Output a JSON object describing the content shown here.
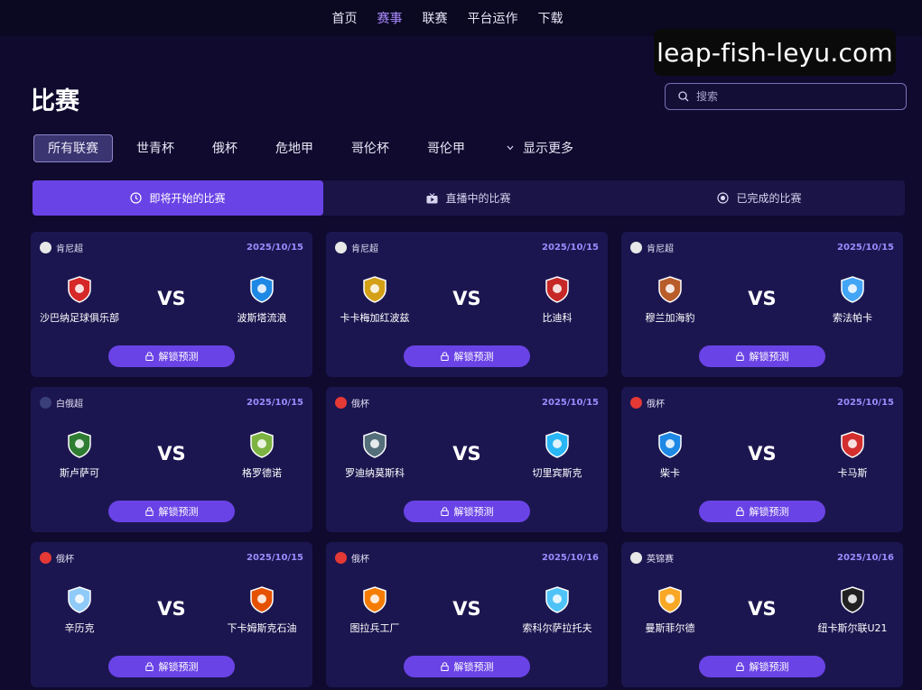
{
  "nav": {
    "items": [
      {
        "label": "首页",
        "active": false
      },
      {
        "label": "赛事",
        "active": true
      },
      {
        "label": "联赛",
        "active": false
      },
      {
        "label": "平台运作",
        "active": false
      },
      {
        "label": "下载",
        "active": false
      }
    ]
  },
  "watermark": "leap-fish-leyu.com",
  "page": {
    "title": "比赛"
  },
  "search": {
    "placeholder": "搜索",
    "value": ""
  },
  "league_filter": {
    "items": [
      "所有联赛",
      "世青杯",
      "俄杯",
      "危地甲",
      "哥伦杯",
      "哥伦甲"
    ],
    "active_index": 0,
    "show_more": "显示更多"
  },
  "status_tabs": [
    {
      "label": "即将开始的比赛",
      "icon": "clock-icon",
      "active": true
    },
    {
      "label": "直播中的比赛",
      "icon": "tv-icon",
      "active": false
    },
    {
      "label": "已完成的比赛",
      "icon": "circle-dot-icon",
      "active": false
    }
  ],
  "vs_label": "VS",
  "unlock_label": "解锁预测",
  "matches": [
    {
      "league": "肯尼超",
      "date": "2025/10/15",
      "home": "沙巴纳足球俱乐部",
      "away": "波斯塔流浪",
      "league_color": "#e8e8e8",
      "home_color": "#d62828",
      "away_color": "#1e88e5"
    },
    {
      "league": "肯尼超",
      "date": "2025/10/15",
      "home": "卡卡梅加红波兹",
      "away": "比迪科",
      "league_color": "#e8e8e8",
      "home_color": "#d4a017",
      "away_color": "#c62828"
    },
    {
      "league": "肯尼超",
      "date": "2025/10/15",
      "home": "穆兰加海豹",
      "away": "索法帕卡",
      "league_color": "#e8e8e8",
      "home_color": "#b85c2a",
      "away_color": "#42a5f5"
    },
    {
      "league": "白俄超",
      "date": "2025/10/15",
      "home": "斯卢萨可",
      "away": "格罗德诺",
      "league_color": "#3a3f7a",
      "home_color": "#2e7d32",
      "away_color": "#7cb342"
    },
    {
      "league": "俄杯",
      "date": "2025/10/15",
      "home": "罗迪纳莫斯科",
      "away": "切里宾斯克",
      "league_color": "#e53935",
      "home_color": "#546e7a",
      "away_color": "#29b6f6"
    },
    {
      "league": "俄杯",
      "date": "2025/10/15",
      "home": "柴卡",
      "away": "卡马斯",
      "league_color": "#e53935",
      "home_color": "#1e88e5",
      "away_color": "#d32f2f"
    },
    {
      "league": "俄杯",
      "date": "2025/10/15",
      "home": "辛历克",
      "away": "下卡姆斯克石油",
      "league_color": "#e53935",
      "home_color": "#90caf9",
      "away_color": "#e65100"
    },
    {
      "league": "俄杯",
      "date": "2025/10/16",
      "home": "图拉兵工厂",
      "away": "索科尔萨拉托夫",
      "league_color": "#e53935",
      "home_color": "#f57c00",
      "away_color": "#4fc3f7"
    },
    {
      "league": "英锦赛",
      "date": "2025/10/16",
      "home": "曼斯菲尔德",
      "away": "纽卡斯尔联U21",
      "league_color": "#e8e8e8",
      "home_color": "#f9a825",
      "away_color": "#212121"
    }
  ]
}
